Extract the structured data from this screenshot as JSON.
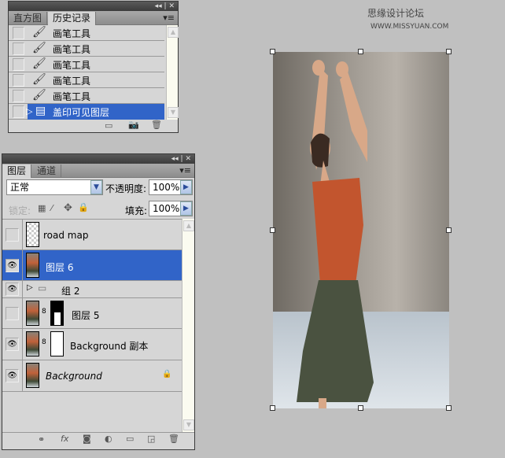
{
  "watermark": {
    "cn": "思缘设计论坛",
    "url": "WWW.MISSYUAN.COM"
  },
  "history_panel": {
    "title_controls": "◂◂ | ✕",
    "tabs": [
      {
        "label": "直方图",
        "active": false
      },
      {
        "label": "历史记录",
        "active": true
      }
    ],
    "menu_icon": "▾≡",
    "items": [
      {
        "label": "画笔工具",
        "icon": "brush-icon",
        "selected": false
      },
      {
        "label": "画笔工具",
        "icon": "brush-icon",
        "selected": false
      },
      {
        "label": "画笔工具",
        "icon": "brush-icon",
        "selected": false
      },
      {
        "label": "画笔工具",
        "icon": "brush-icon",
        "selected": false
      },
      {
        "label": "画笔工具",
        "icon": "brush-icon",
        "selected": false
      },
      {
        "label": "盖印可见图层",
        "icon": "document-icon",
        "selected": true
      }
    ]
  },
  "layers_panel": {
    "title_controls": "◂◂ | ✕",
    "tabs": [
      {
        "label": "图层",
        "active": true
      },
      {
        "label": "通道",
        "active": false
      }
    ],
    "menu_icon": "▾≡",
    "blend_mode": "正常",
    "opacity_label": "不透明度:",
    "opacity": "100%",
    "lock_label": "锁定:",
    "fill_label": "填充:",
    "fill": "100%",
    "layers": [
      {
        "name": "road map",
        "visible": false,
        "selected": false
      },
      {
        "name": "图层 6",
        "visible": true,
        "selected": true
      },
      {
        "name": "组 2",
        "visible": true,
        "selected": false,
        "group": true
      },
      {
        "name": "图层 5",
        "visible": false,
        "selected": false,
        "mask": "silhouette"
      },
      {
        "name": "Background 副本",
        "visible": true,
        "selected": false,
        "mask": "white"
      },
      {
        "name": "Background",
        "visible": true,
        "selected": false,
        "locked": true
      }
    ]
  },
  "colors": {
    "selection": "#3164c8",
    "panel": "#d6d6d6",
    "workspace": "#c0c0c0"
  }
}
